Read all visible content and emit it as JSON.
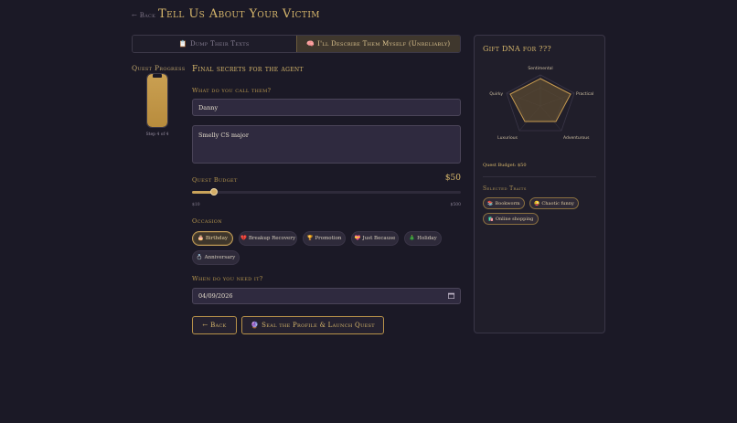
{
  "header": {
    "back_label": "← Back",
    "title": "Tell Us About Your Victim"
  },
  "tabs": [
    {
      "icon": "📋",
      "label": "Dump Their Texts",
      "active": false
    },
    {
      "icon": "🧠",
      "label": "I'll Describe Them Myself (Unreliably)",
      "active": true
    }
  ],
  "progress": {
    "label": "Quest Progress",
    "step_text": "Step 4 of 4",
    "fraction": 1.0
  },
  "form": {
    "section_title": "Final secrets for the agent",
    "name_label": "What do you call them?",
    "name_value": "Danny",
    "notes_value": "Smelly CS major",
    "budget_label": "Quest Budget",
    "budget_display": "$50",
    "budget_value": 50,
    "budget_min": "$10",
    "budget_max": "$500",
    "occasion_label": "Occasion",
    "occasions": [
      {
        "icon": "🎂",
        "label": "Birthday",
        "selected": true
      },
      {
        "icon": "💔",
        "label": "Breakup Recovery",
        "selected": false
      },
      {
        "icon": "🏆",
        "label": "Promotion",
        "selected": false
      },
      {
        "icon": "💝",
        "label": "Just Because",
        "selected": false
      },
      {
        "icon": "🎄",
        "label": "Holiday",
        "selected": false
      },
      {
        "icon": "💍",
        "label": "Anniversary",
        "selected": false
      }
    ],
    "date_label": "When do you need it?",
    "date_value": "04/09/2026",
    "back_button": "← Back",
    "launch_button": "Seal the Profile & Launch Quest",
    "launch_icon": "🔮"
  },
  "panel": {
    "title": "Gift DNA for ???",
    "radar_axes": [
      "Sentimental",
      "Practical",
      "Adventurous",
      "Luxurious",
      "Quirky"
    ],
    "budget_text": "Quest Budget: $50",
    "traits_label": "Selected Traits",
    "traits": [
      {
        "icon": "📚",
        "label": "Bookworm"
      },
      {
        "icon": "😜",
        "label": "Chaotic funny"
      },
      {
        "icon": "🛍️",
        "label": "Online shopping"
      }
    ]
  },
  "colors": {
    "background": "#1b1926",
    "accent": "#d8b86c",
    "panel": "#201e2a",
    "input": "#2f2a3f"
  }
}
